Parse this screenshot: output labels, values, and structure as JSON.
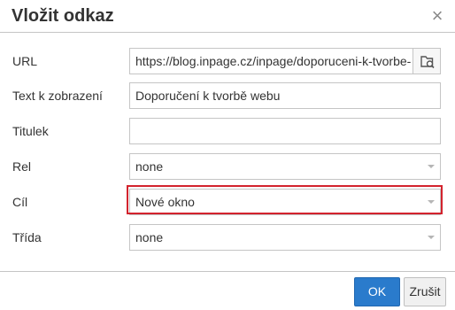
{
  "dialog": {
    "title": "Vložit odkaz",
    "close_icon": "close-icon"
  },
  "form": {
    "url": {
      "label": "URL",
      "value": "https://blog.inpage.cz/inpage/doporuceni-k-tvorbe-",
      "browse_icon": "folder-search-icon"
    },
    "text": {
      "label": "Text k zobrazení",
      "value": "Doporučení k tvorbě webu"
    },
    "title": {
      "label": "Titulek",
      "value": ""
    },
    "rel": {
      "label": "Rel",
      "value": "none"
    },
    "target": {
      "label": "Cíl",
      "value": "Nové okno"
    },
    "class": {
      "label": "Třída",
      "value": "none"
    }
  },
  "footer": {
    "ok_label": "OK",
    "cancel_label": "Zrušit"
  },
  "colors": {
    "accent": "#2a7bcc",
    "highlight": "#d3232d"
  }
}
